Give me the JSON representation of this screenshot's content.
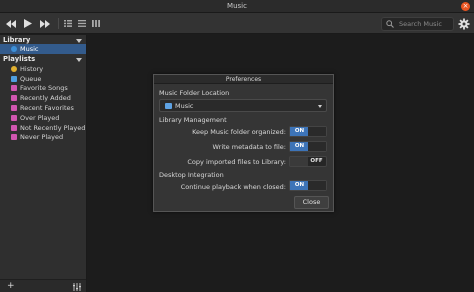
{
  "window": {
    "title": "Music"
  },
  "toolbar": {
    "search_placeholder": "Search Music"
  },
  "sidebar": {
    "library_heading": "Library",
    "library_items": [
      {
        "label": "Music",
        "icon": "music-note-icon",
        "color": "#3d8fd6",
        "selected": true
      }
    ],
    "playlists_heading": "Playlists",
    "playlist_items": [
      {
        "label": "History",
        "icon": "history-icon",
        "color": "#e0b030"
      },
      {
        "label": "Queue",
        "icon": "queue-icon",
        "color": "#4f9fe0"
      },
      {
        "label": "Favorite Songs",
        "icon": "smart-playlist-icon",
        "color": "#d056b0"
      },
      {
        "label": "Recently Added",
        "icon": "smart-playlist-icon",
        "color": "#d056b0"
      },
      {
        "label": "Recent Favorites",
        "icon": "smart-playlist-icon",
        "color": "#d056b0"
      },
      {
        "label": "Over Played",
        "icon": "smart-playlist-icon",
        "color": "#d056b0"
      },
      {
        "label": "Not Recently Played",
        "icon": "smart-playlist-icon",
        "color": "#d056b0"
      },
      {
        "label": "Never Played",
        "icon": "smart-playlist-icon",
        "color": "#d056b0"
      }
    ],
    "add_label": "+"
  },
  "dialog": {
    "title": "Preferences",
    "music_folder_heading": "Music Folder Location",
    "music_folder_value": "Music",
    "library_management_heading": "Library Management",
    "rows": [
      {
        "label": "Keep Music folder organized:",
        "state": "ON",
        "on": true
      },
      {
        "label": "Write metadata to file:",
        "state": "ON",
        "on": true
      },
      {
        "label": "Copy imported files to Library:",
        "state": "OFF",
        "on": false
      }
    ],
    "desktop_heading": "Desktop Integration",
    "desktop_rows": [
      {
        "label": "Continue playback when closed:",
        "state": "ON",
        "on": true
      }
    ],
    "close_label": "Close"
  },
  "colors": {
    "accent": "#3d74b8",
    "selected": "#335b8c",
    "close_button": "#e95420"
  }
}
